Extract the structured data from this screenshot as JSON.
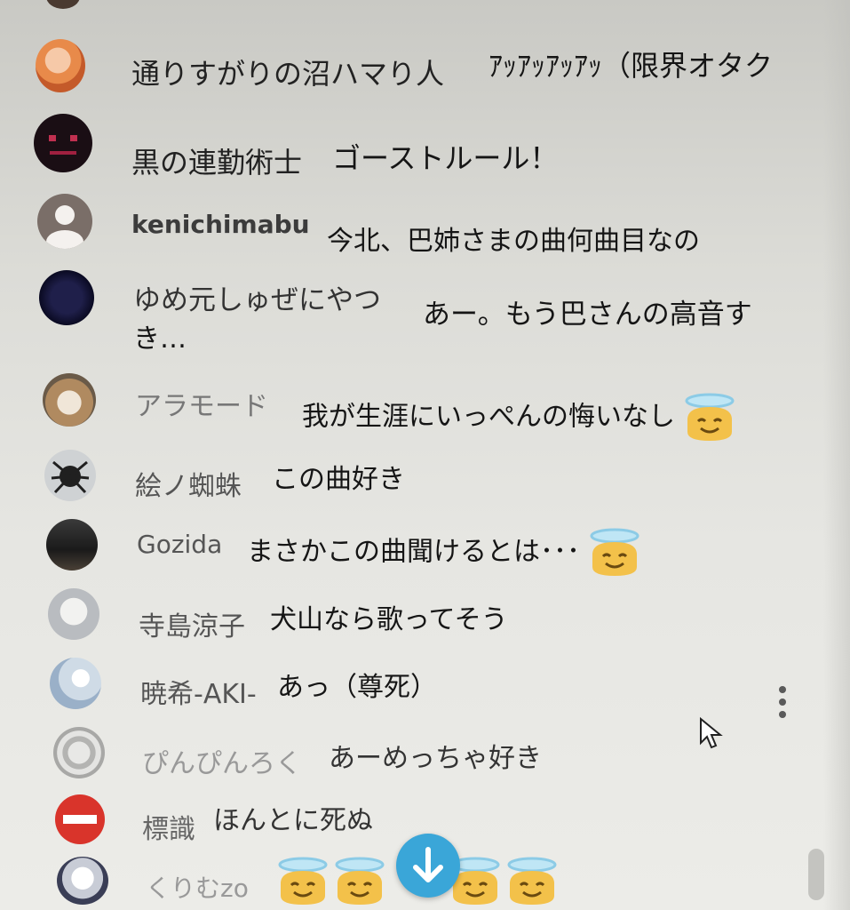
{
  "messages": [
    {
      "author": "通りすがりの沼ハマり人",
      "text": "ｱｯｱｯｱｯｱｯ（限界オタク",
      "avatar": "anime-girl-avatar"
    },
    {
      "author": "黒の連勤術士",
      "text": "ゴーストルール！",
      "avatar": "dark-face-avatar"
    },
    {
      "author": "kenichimabu",
      "text": "今北、巴姉さまの曲何曲目なの",
      "avatar": "default-user-avatar"
    },
    {
      "author": "ゆめ元しゅぜにやつ",
      "text_line1": "あー。もう巴さんの高音す",
      "text_line2": "き…",
      "avatar": "dark-avatar"
    },
    {
      "author": "アラモード",
      "text": "我が生涯にいっぺんの悔いなし",
      "avatar": "cat-avatar",
      "emoji": "smiling-halo-emoji"
    },
    {
      "author": "絵ノ蜘蛛",
      "text": "この曲好き",
      "avatar": "spider-avatar"
    },
    {
      "author": "Gozida",
      "text": "まさかこの曲聞けるとは･･･",
      "avatar": "photo-avatar",
      "emoji": "smiling-halo-emoji"
    },
    {
      "author": "寺島涼子",
      "text": "犬山なら歌ってそう",
      "avatar": "light-avatar"
    },
    {
      "author": "暁希-AKI-",
      "text": "あっ（尊死）",
      "avatar": "pattern-avatar"
    },
    {
      "author": "ぴんぴんろく",
      "text": "あーめっちゃ好き",
      "avatar": "lace-avatar"
    },
    {
      "author": "標識",
      "text": "ほんとに死ぬ",
      "avatar": "no-entry-sign-avatar"
    },
    {
      "author": "くりむzo",
      "text": "",
      "avatar": "character-avatar",
      "emoji": "smiling-halo-emoji"
    }
  ],
  "colors": {
    "scroll_button": "#3aa6d8",
    "emoji_face": "#f3c14a",
    "halo": "#bfe6f5",
    "no_entry": "#d9342b"
  },
  "icons": {
    "scroll_button": "arrow-down-icon",
    "menu": "more-vert-icon",
    "cursor": "mouse-pointer-icon"
  }
}
